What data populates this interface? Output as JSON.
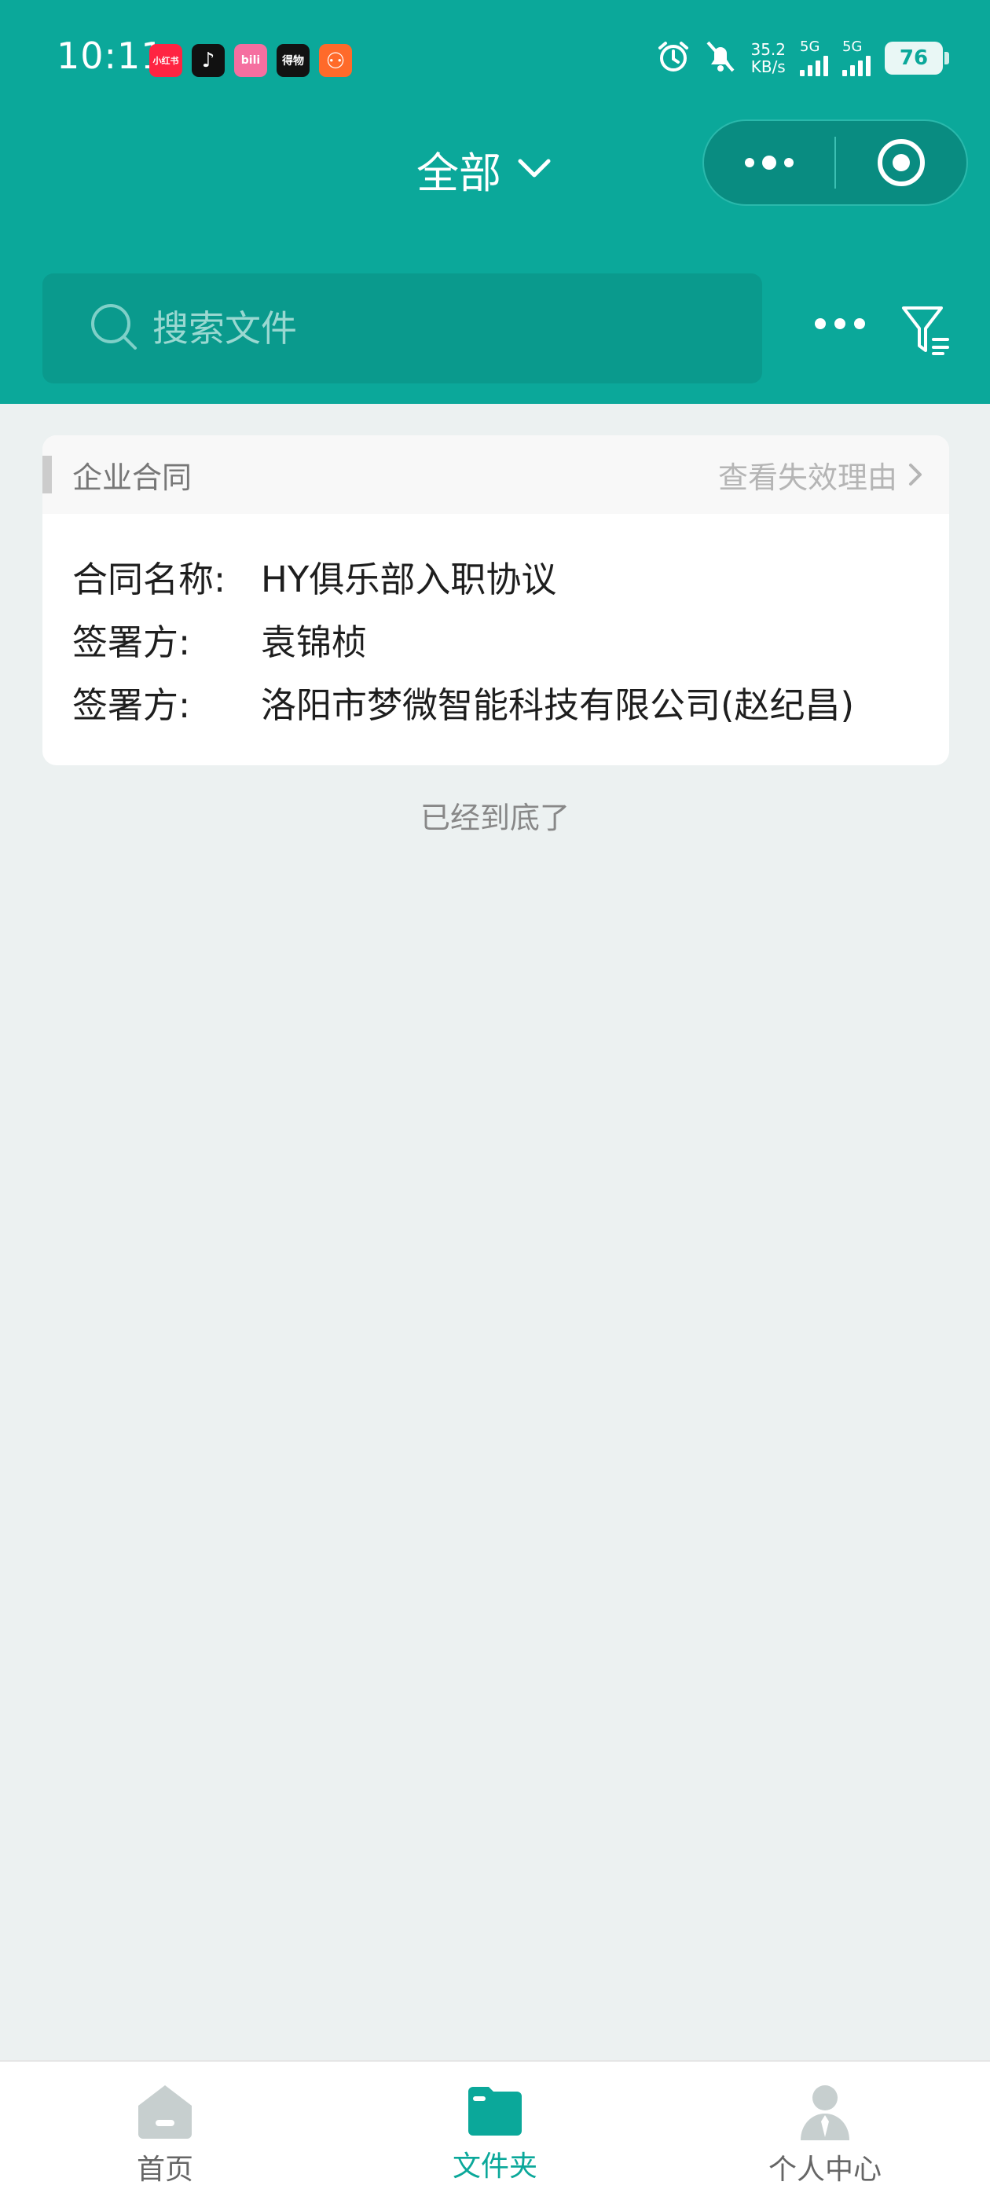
{
  "status_bar": {
    "time": "10:11",
    "apps": [
      {
        "icon": "xiaohongshu-icon",
        "text": "小红书",
        "color": "#ff2442"
      },
      {
        "icon": "douyin-icon",
        "text": "♪",
        "color": "#111111"
      },
      {
        "icon": "bilibili-icon",
        "text": "bili",
        "color": "#f56fa0"
      },
      {
        "icon": "dewu-icon",
        "text": "得物",
        "color": "#121212"
      },
      {
        "icon": "taobao-icon",
        "text": "⚇",
        "color": "#ff6a2a"
      }
    ],
    "net_speed_value": "35.2",
    "net_speed_unit": "KB/s",
    "sim1": "5G",
    "sim2": "5G",
    "battery": "76"
  },
  "header": {
    "title": "全部"
  },
  "search": {
    "placeholder": "搜索文件"
  },
  "card": {
    "tag": "企业合同",
    "link": "查看失效理由",
    "rows": [
      {
        "label": "合同名称:",
        "value": "HY俱乐部入职协议"
      },
      {
        "label": "签署方:",
        "value": "袁锦桢"
      },
      {
        "label": "签署方:",
        "value": "洛阳市梦微智能科技有限公司(赵纪昌)"
      }
    ]
  },
  "end_text": "已经到底了",
  "tabbar": {
    "tabs": [
      {
        "label": "首页",
        "icon": "home-icon",
        "active": false
      },
      {
        "label": "文件夹",
        "icon": "folder-icon",
        "active": true
      },
      {
        "label": "个人中心",
        "icon": "user-icon",
        "active": false
      }
    ]
  },
  "colors": {
    "primary": "#0ba89a",
    "background": "#ecf1f1",
    "inactive_icon": "#c7cfcf"
  }
}
